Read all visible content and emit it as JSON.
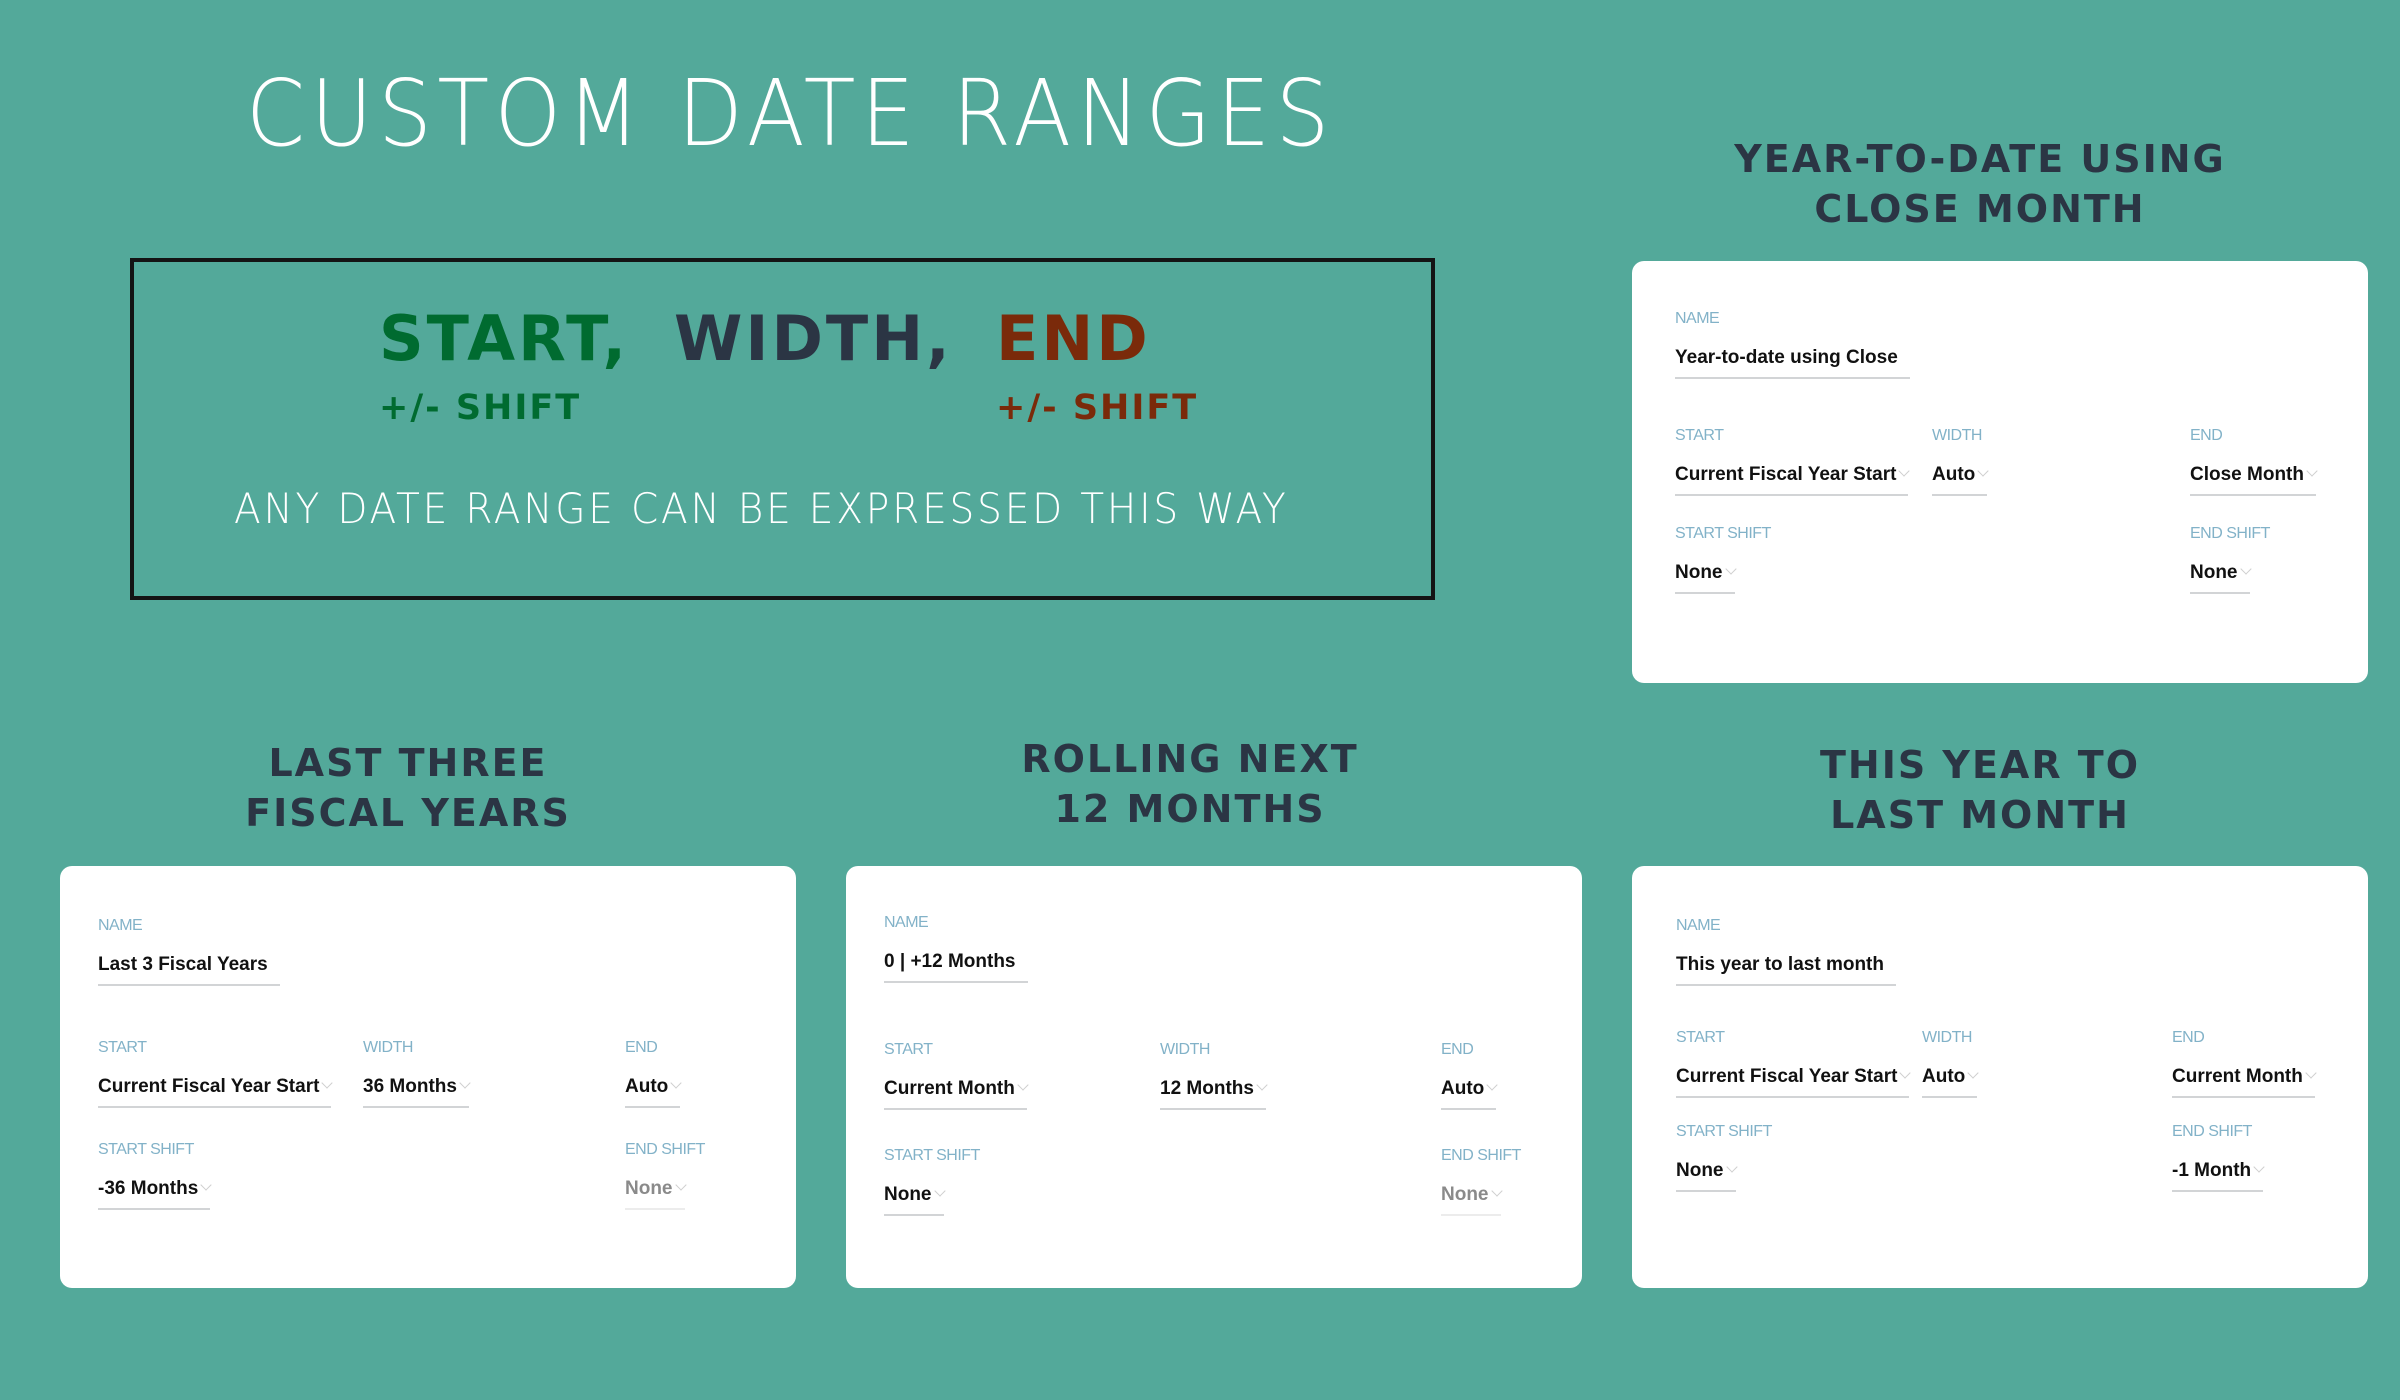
{
  "page": {
    "title": "CUSTOM DATE RANGES"
  },
  "formula": {
    "start": "START,",
    "width": "WIDTH,",
    "end": "END",
    "start_shift": "+/- SHIFT",
    "end_shift": "+/- SHIFT",
    "subtitle": "ANY DATE RANGE CAN BE EXPRESSED THIS WAY",
    "colors": {
      "start": "#006b30",
      "width": "#2b3544",
      "end": "#7a2a0a"
    }
  },
  "examples": [
    {
      "heading_line1": "YEAR-TO-DATE USING",
      "heading_line2": "CLOSE MONTH",
      "labels": {
        "name": "NAME",
        "start": "START",
        "width": "WIDTH",
        "end": "END",
        "start_shift": "START SHIFT",
        "end_shift": "END SHIFT"
      },
      "name": "Year-to-date using Close",
      "start": "Current Fiscal Year Start",
      "width": "Auto",
      "end": "Close Month",
      "start_shift": "None",
      "end_shift": "None",
      "end_shift_disabled": false
    },
    {
      "heading_line1": "LAST THREE",
      "heading_line2": "FISCAL YEARS",
      "labels": {
        "name": "NAME",
        "start": "START",
        "width": "WIDTH",
        "end": "END",
        "start_shift": "START SHIFT",
        "end_shift": "END SHIFT"
      },
      "name": "Last 3 Fiscal Years",
      "start": "Current Fiscal Year Start",
      "width": "36 Months",
      "end": "Auto",
      "start_shift": "-36 Months",
      "end_shift": "None",
      "end_shift_disabled": true
    },
    {
      "heading_line1": "ROLLING NEXT",
      "heading_line2": "12 MONTHS",
      "labels": {
        "name": "NAME",
        "start": "START",
        "width": "WIDTH",
        "end": "END",
        "start_shift": "START SHIFT",
        "end_shift": "END SHIFT"
      },
      "name": "0 | +12 Months",
      "start": "Current Month",
      "width": "12 Months",
      "end": "Auto",
      "start_shift": "None",
      "end_shift": "None",
      "end_shift_disabled": true
    },
    {
      "heading_line1": "THIS YEAR TO",
      "heading_line2": "LAST MONTH",
      "labels": {
        "name": "NAME",
        "start": "START",
        "width": "WIDTH",
        "end": "END",
        "start_shift": "START SHIFT",
        "end_shift": "END SHIFT"
      },
      "name": "This year to last month",
      "start": "Current Fiscal Year Start",
      "width": "Auto",
      "end": "Current Month",
      "start_shift": "None",
      "end_shift": "-1 Month",
      "end_shift_disabled": false
    }
  ]
}
